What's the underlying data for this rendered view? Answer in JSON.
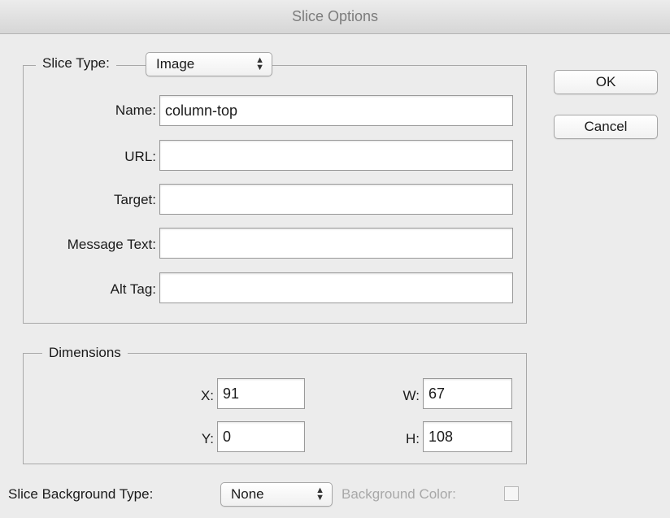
{
  "window": {
    "title": "Slice Options"
  },
  "slice_group": {
    "label": "Slice Type:",
    "type_value": "Image",
    "fields": {
      "name_label": "Name:",
      "name_value": "column-top",
      "url_label": "URL:",
      "url_value": "",
      "target_label": "Target:",
      "target_value": "",
      "message_label": "Message Text:",
      "message_value": "",
      "alt_label": "Alt Tag:",
      "alt_value": ""
    }
  },
  "dimensions": {
    "label": "Dimensions",
    "x_label": "X:",
    "x_value": "91",
    "y_label": "Y:",
    "y_value": "0",
    "w_label": "W:",
    "w_value": "67",
    "h_label": "H:",
    "h_value": "108"
  },
  "background": {
    "type_label": "Slice Background Type:",
    "type_value": "None",
    "color_label": "Background Color:"
  },
  "buttons": {
    "ok": "OK",
    "cancel": "Cancel"
  },
  "icons": {
    "select_arrows": "up-down-chevron-icon"
  }
}
